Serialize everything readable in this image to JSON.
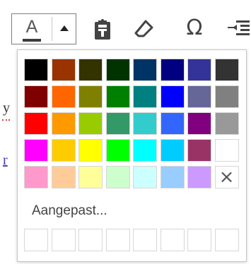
{
  "toolbar": {
    "text_color_icon": "A",
    "text_color_value": "#3c3c3c",
    "open_icon": "caret-up-icon",
    "paste_icon": "paste-icon",
    "eraser_icon": "eraser-icon",
    "special_char_icon": "Ω",
    "indent_icon": "indent-icon"
  },
  "editor_fragments": {
    "line1_start": "y",
    "line1_end": ":",
    "line2_start": "r"
  },
  "palette": {
    "rows": [
      [
        "#000000",
        "#993300",
        "#333300",
        "#003300",
        "#003366",
        "#000080",
        "#333399",
        "#333333"
      ],
      [
        "#800000",
        "#FF6600",
        "#808000",
        "#008000",
        "#008080",
        "#0000FF",
        "#666699",
        "#808080"
      ],
      [
        "#FF0000",
        "#FF9900",
        "#99CC00",
        "#339966",
        "#33CCCC",
        "#3366FF",
        "#800080",
        "#999999"
      ],
      [
        "#FF00FF",
        "#FFCC00",
        "#FFFF00",
        "#00FF00",
        "#00FFFF",
        "#00CCFF",
        "#993366",
        "#FFFFFF"
      ],
      [
        "#FF99CC",
        "#FFCC99",
        "#FFFF99",
        "#CCFFCC",
        "#CCFFFF",
        "#99CCFF",
        "#CC99FF",
        "remove"
      ]
    ],
    "remove_label": "×",
    "custom_label": "Aangepast...",
    "custom_slots": [
      "",
      "",
      "",
      "",
      "",
      "",
      "",
      ""
    ]
  }
}
